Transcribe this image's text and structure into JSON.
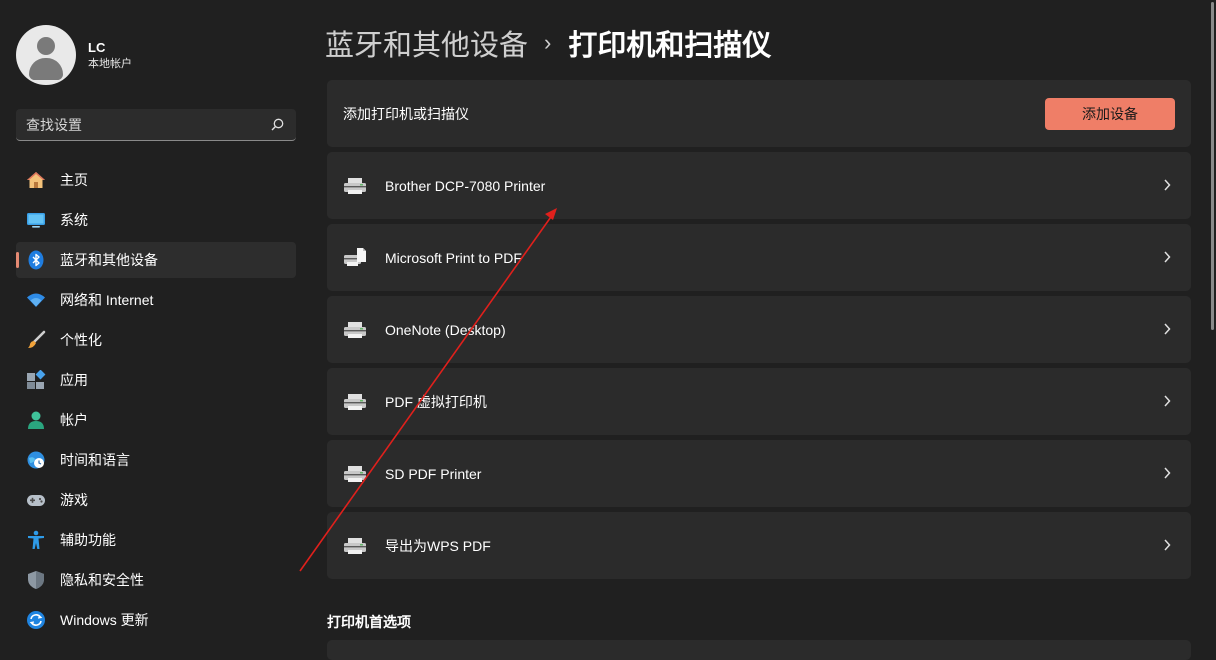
{
  "profile": {
    "name": "LC",
    "account_type": "本地帐户"
  },
  "search": {
    "placeholder": "查找设置"
  },
  "sidebar": {
    "items": [
      {
        "label": "主页"
      },
      {
        "label": "系统"
      },
      {
        "label": "蓝牙和其他设备",
        "active": true
      },
      {
        "label": "网络和 Internet"
      },
      {
        "label": "个性化"
      },
      {
        "label": "应用"
      },
      {
        "label": "帐户"
      },
      {
        "label": "时间和语言"
      },
      {
        "label": "游戏"
      },
      {
        "label": "辅助功能"
      },
      {
        "label": "隐私和安全性"
      },
      {
        "label": "Windows 更新"
      }
    ]
  },
  "breadcrumb": {
    "parent": "蓝牙和其他设备",
    "separator": "›",
    "current": "打印机和扫描仪"
  },
  "add_printer": {
    "label": "添加打印机或扫描仪",
    "button_label": "添加设备"
  },
  "printers": [
    {
      "name": "Brother DCP-7080 Printer"
    },
    {
      "name": "Microsoft Print to PDF"
    },
    {
      "name": "OneNote (Desktop)"
    },
    {
      "name": "PDF 虚拟打印机"
    },
    {
      "name": "SD PDF Printer"
    },
    {
      "name": "导出为WPS PDF"
    }
  ],
  "preferences": {
    "title": "打印机首选项"
  },
  "colors": {
    "accent": "#ef7e67",
    "background": "#202020",
    "card": "#2b2b2b",
    "annotation_arrow": "#e0201c"
  }
}
